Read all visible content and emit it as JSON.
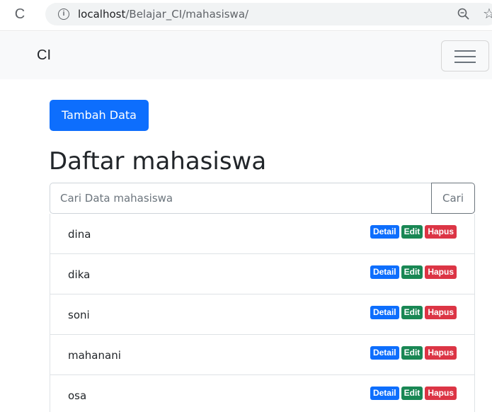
{
  "browser": {
    "url_host": "localhost",
    "url_path": "/Belajar_CI/mahasiswa/",
    "reload_icon": "reload-icon",
    "info_icon": "info-icon",
    "zoom_icon": "zoom-icon",
    "star_icon": "star-icon"
  },
  "navbar": {
    "brand": "CI",
    "toggler_icon": "hamburger-icon"
  },
  "main": {
    "add_button": "Tambah Data",
    "title": "Daftar mahasiswa",
    "search": {
      "placeholder": "Cari Data mahasiswa",
      "button": "Cari"
    },
    "actions": {
      "detail": "Detail",
      "edit": "Edit",
      "hapus": "Hapus"
    },
    "students": [
      {
        "name": "dina"
      },
      {
        "name": "dika"
      },
      {
        "name": "soni"
      },
      {
        "name": "mahanani"
      },
      {
        "name": "osa"
      }
    ]
  },
  "colors": {
    "primary": "#0d6efd",
    "success": "#198754",
    "danger": "#dc3545"
  }
}
